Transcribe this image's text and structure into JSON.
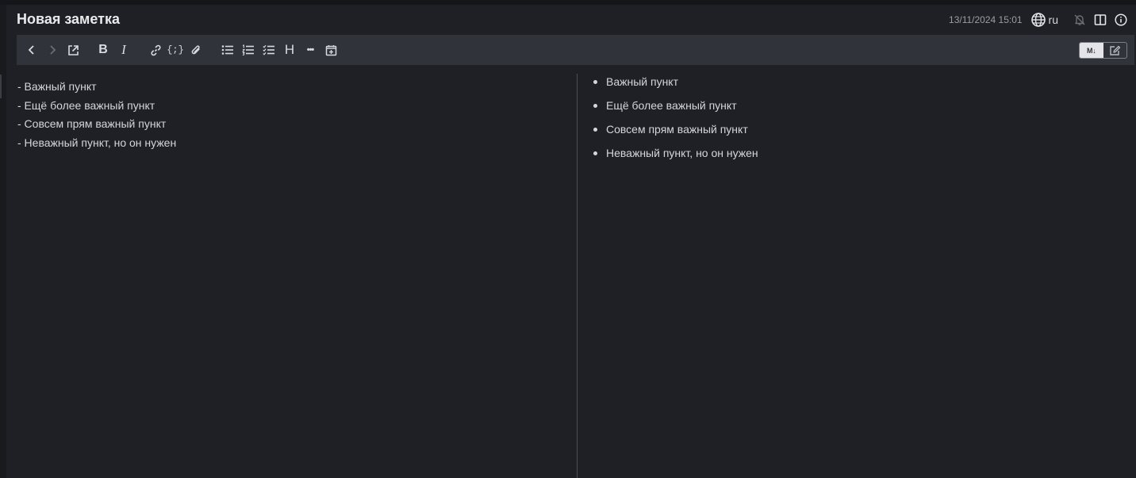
{
  "note": {
    "title": "Новая заметка",
    "timestamp": "13/11/2024 15:01",
    "language": "ru"
  },
  "toolbar": {
    "buttons": [
      {
        "name": "back",
        "icon": "chevron-left-icon"
      },
      {
        "name": "forward",
        "icon": "chevron-right-icon"
      },
      {
        "name": "open-external",
        "icon": "external-link-icon"
      },
      {
        "name": "bold",
        "label": "B"
      },
      {
        "name": "italic",
        "label": "I"
      },
      {
        "name": "link",
        "icon": "link-icon"
      },
      {
        "name": "code",
        "label": "{;}"
      },
      {
        "name": "attach",
        "icon": "paperclip-icon"
      },
      {
        "name": "bullet-list",
        "icon": "bullet-list-icon"
      },
      {
        "name": "numbered-list",
        "icon": "numbered-list-icon"
      },
      {
        "name": "checklist",
        "icon": "checklist-icon"
      },
      {
        "name": "heading",
        "label": "H"
      },
      {
        "name": "more",
        "label": "•••"
      },
      {
        "name": "insert-date",
        "icon": "calendar-plus-icon"
      }
    ],
    "mode_switch": {
      "markdown_label": "M↓",
      "edit_icon": "edit-icon",
      "active": "markdown"
    }
  },
  "editor": {
    "source": "- Важный пункт\n- Ещё более важный пункт\n- Совсем прям важный пункт\n- Неважный пункт, но он нужен"
  },
  "preview": {
    "items": [
      "Важный пункт",
      "Ещё более важный пункт",
      "Совсем прям важный пункт",
      "Неважный пункт, но он нужен"
    ]
  },
  "colors": {
    "background": "#1e2025",
    "toolbar": "#30333a",
    "text": "#d4d6da",
    "muted": "#9a9da4"
  }
}
